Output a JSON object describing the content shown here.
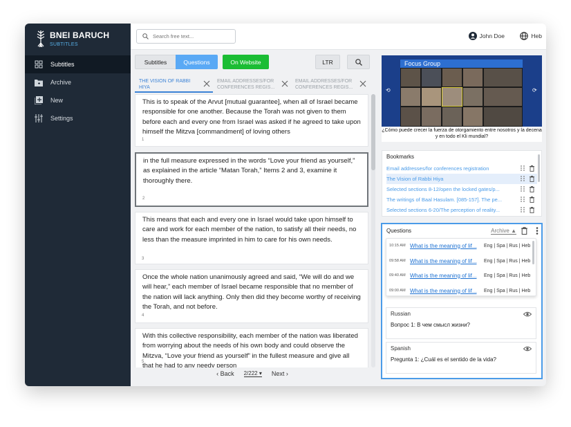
{
  "brand": {
    "title": "BNEI BARUCH",
    "subtitle": "SUBTITLES"
  },
  "sidebar": {
    "items": [
      {
        "label": "Subtitles",
        "icon": "grid-icon",
        "active": true
      },
      {
        "label": "Archive",
        "icon": "folder-icon",
        "active": false
      },
      {
        "label": "New",
        "icon": "add-box-icon",
        "active": false
      },
      {
        "label": "Settings",
        "icon": "sliders-icon",
        "active": false
      }
    ]
  },
  "topbar": {
    "search_placeholder": "Search free text...",
    "user_name": "John Doe",
    "language": "Heb"
  },
  "toolbar": {
    "subtitles_label": "Subtitles",
    "questions_label": "Questions",
    "website_label": "On Website",
    "direction_label": "LTR"
  },
  "tabs": [
    {
      "label": "THE VISION OF RABBI HIYA",
      "active": true
    },
    {
      "label": "EMAIL ADDRESSES/FOR CONFERENCES REGIS...",
      "active": false
    },
    {
      "label": "EMAIL ADDRESSES/FOR CONFERENCES REGIS...",
      "active": false
    }
  ],
  "subtitles": [
    {
      "num": "1",
      "text": "This is to speak of the Arvut [mutual guarantee], when all of Israel became responsible for one another. Because the Torah was not given to them before each and every one from Israel was asked if he agreed to take upon himself the Mitzva [commandment] of loving others"
    },
    {
      "num": "2",
      "text": "in the full measure expressed in the words “Love your friend as yourself,” as explained in the article “Matan Torah,” Items 2 and 3, examine it thoroughly there."
    },
    {
      "num": "3",
      "text": "This means that each and every one in Israel would take upon himself to care and work for each member of the nation, to satisfy all their needs, no less than the measure imprinted in him to care for his own needs."
    },
    {
      "num": "4",
      "text": "Once the whole nation unanimously agreed and said, “We will do and we will hear,” each member of Israel became responsible that no member of the nation will lack anything. Only then did they become worthy of receiving the Torah, and not before."
    },
    {
      "num": "5",
      "text": "With this collective responsibility, each member of the nation was liberated from worrying about the needs of his own body and could observe the Mitzva, “Love your friend as yourself” in the fullest measure and give all that he had to any needy person"
    }
  ],
  "pager": {
    "back": "‹ Back",
    "page": "2/222 ▾",
    "next": "Next ›"
  },
  "video": {
    "title": "Focus Group",
    "caption": "¿Cómo puede crecer la fuerza de otorgamiento entre nosotros y la decena y en todo el Kli mundial?"
  },
  "bookmarks": {
    "header": "Bookmarks",
    "items": [
      {
        "label": "Email addresses/for conferences registration",
        "active": false
      },
      {
        "label": "The Vision of Rabbi Hiya",
        "active": true
      },
      {
        "label": "Selected sections 8-12/open the locked gates/p...",
        "active": false
      },
      {
        "label": "The writings of Baal Hasulam. [085-157]. The pe...",
        "active": false
      },
      {
        "label": "Selected sections 6-20/The perception of reality...",
        "active": false
      }
    ]
  },
  "questions": {
    "header": "Questions",
    "archive_label": "Archive ▲",
    "items": [
      {
        "time": "10:15 AM",
        "text": "What is the meaning of lif...",
        "langs": "Eng | Spa | Rus | Heb"
      },
      {
        "time": "09:58 AM",
        "text": "What is the meaning of lif...",
        "langs": "Eng | Spa | Rus | Heb"
      },
      {
        "time": "09:40 AM",
        "text": "What is the meaning of lif...",
        "langs": "Eng | Spa | Rus | Heb"
      },
      {
        "time": "09:00 AM",
        "text": "What is the meaning of lif...",
        "langs": "Eng | Spa | Rus | Heb"
      }
    ],
    "translations": [
      {
        "language": "Russian",
        "text": "Вопрос 1: В чем смысл жизни?"
      },
      {
        "language": "Spanish",
        "text": "Pregunta 1: ¿Cuál es el sentido de la vida?"
      }
    ]
  }
}
